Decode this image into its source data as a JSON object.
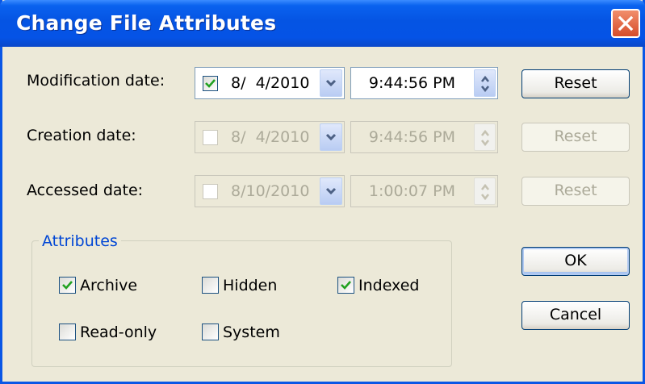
{
  "window": {
    "title": "Change File Attributes"
  },
  "rows": [
    {
      "label": "Modification date:",
      "checked": true,
      "enabled": true,
      "date": "8/  4/2010",
      "time": "9:44:56 PM",
      "reset_label": "Reset"
    },
    {
      "label": "Creation date:",
      "checked": false,
      "enabled": false,
      "date": "8/  4/2010",
      "time": "9:44:56 PM",
      "reset_label": "Reset"
    },
    {
      "label": "Accessed date:",
      "checked": false,
      "enabled": false,
      "date": "8/10/2010",
      "time": "1:00:07 PM",
      "reset_label": "Reset"
    }
  ],
  "attributes": {
    "group_title": "Attributes",
    "archive": {
      "label": "Archive",
      "checked": true
    },
    "hidden": {
      "label": "Hidden",
      "checked": false
    },
    "indexed": {
      "label": "Indexed",
      "checked": true
    },
    "read_only": {
      "label": "Read-only",
      "checked": false
    },
    "system": {
      "label": "System",
      "checked": false
    }
  },
  "buttons": {
    "ok_label": "OK",
    "cancel_label": "Cancel"
  },
  "colors": {
    "titlebar": "#0553e6",
    "dialog_bg": "#ece9d8",
    "group_title": "#0046d5",
    "check": "#21a121"
  }
}
